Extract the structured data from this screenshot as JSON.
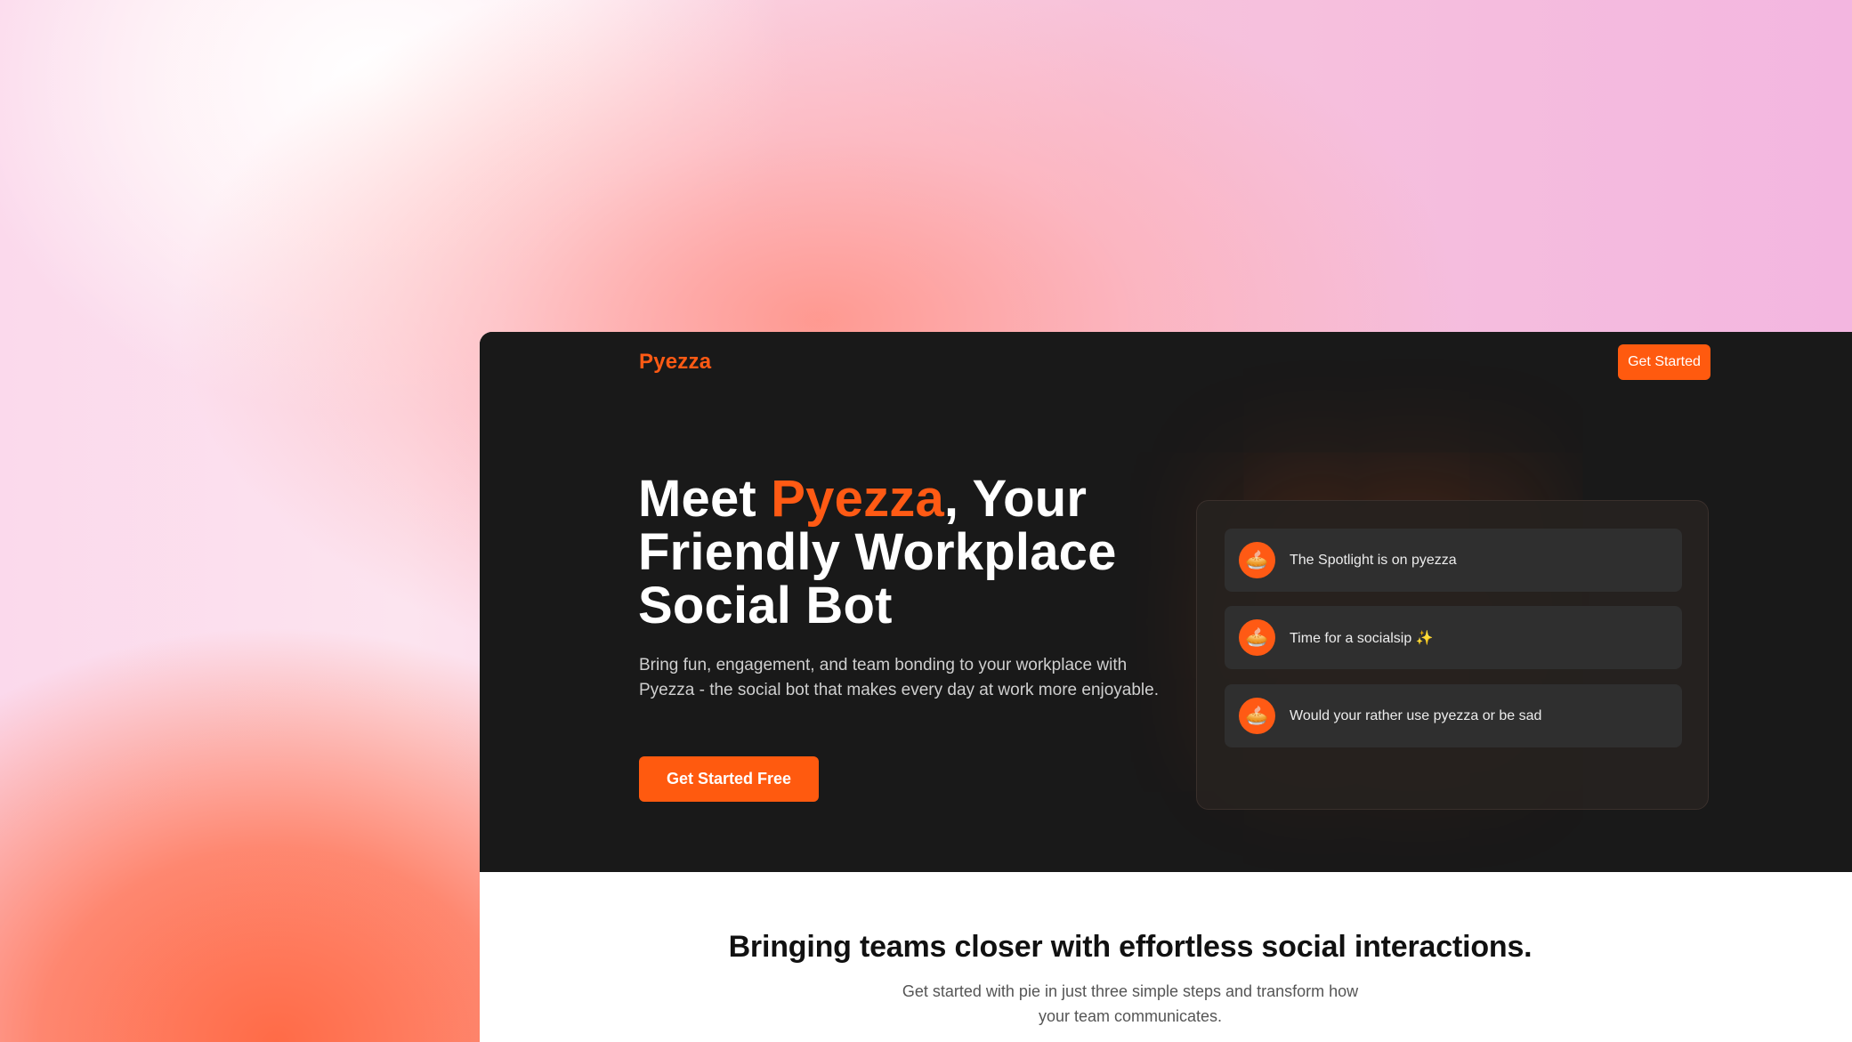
{
  "nav": {
    "logo": "Pyezza",
    "cta_label": "Get Started"
  },
  "hero": {
    "title_prefix": "Meet ",
    "title_accent": "Pyezza",
    "title_suffix": ", Your Friendly Workplace Social Bot",
    "subtitle": "Bring fun, engagement, and team bonding to your workplace with Pyezza - the social bot that makes every day at work more enjoyable.",
    "cta_label": "Get Started Free"
  },
  "chat": {
    "avatar_glyph": "🥧",
    "messages": [
      {
        "text": "The Spotlight is on pyezza"
      },
      {
        "text": "Time for a socialsip ✨"
      },
      {
        "text": "Would your rather use pyezza or be sad"
      }
    ]
  },
  "section": {
    "title": "Bringing teams closer with effortless social interactions.",
    "subtitle": "Get started with pie in just three simple steps and transform how your team communicates."
  },
  "colors": {
    "accent": "#ff5a14",
    "hero_bg": "#191919"
  },
  "icons": {
    "avatar": "pie-icon"
  }
}
